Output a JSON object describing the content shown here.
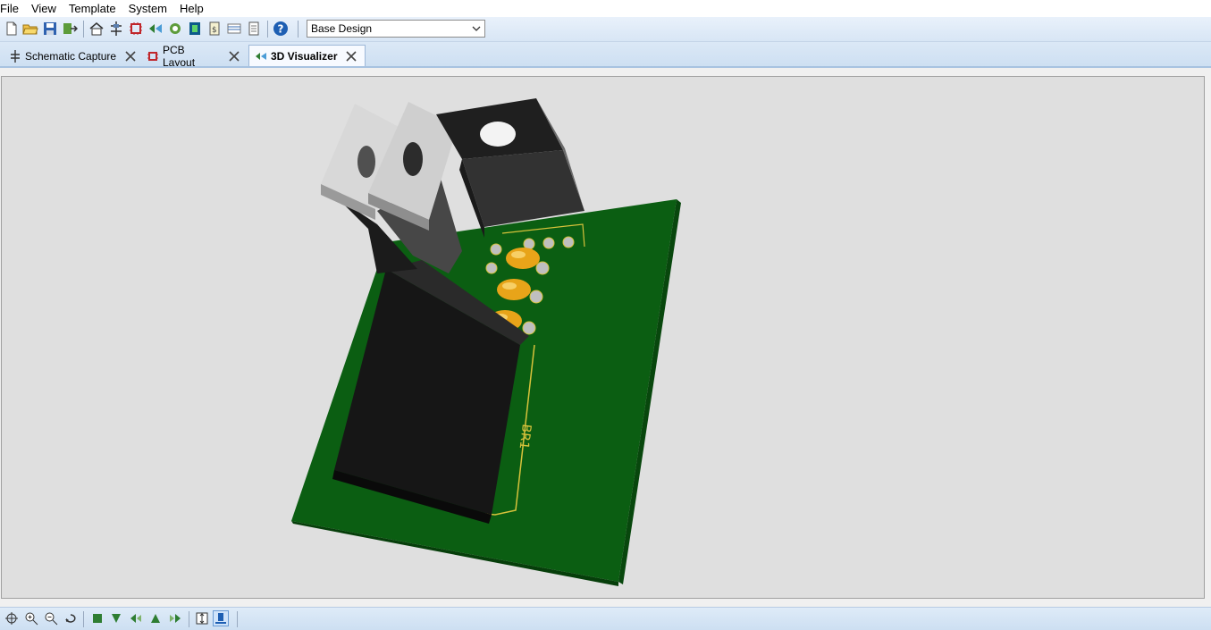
{
  "menu": {
    "items": [
      {
        "label": "File"
      },
      {
        "label": "View"
      },
      {
        "label": "Template"
      },
      {
        "label": "System"
      },
      {
        "label": "Help"
      }
    ]
  },
  "toolbar": {
    "design_select": {
      "value": "Base Design"
    }
  },
  "tabs": [
    {
      "label": "Schematic Capture",
      "active": false
    },
    {
      "label": "PCB Layout",
      "active": false
    },
    {
      "label": "3D Visualizer",
      "active": true
    }
  ],
  "scene": {
    "board_silkscreen_label": "BR1",
    "colors": {
      "pcb": "#0b5e12",
      "silkscreen": "#d7c23b",
      "capacitor": "#e8a419",
      "regulator_black": "#1a1a1a",
      "heatsink_silver": "#c8c8c8",
      "background": "#dfdfdf"
    }
  },
  "colors": {
    "toolbar_bg": "#d8e6f5",
    "help_icon": "#1e5fb3"
  }
}
